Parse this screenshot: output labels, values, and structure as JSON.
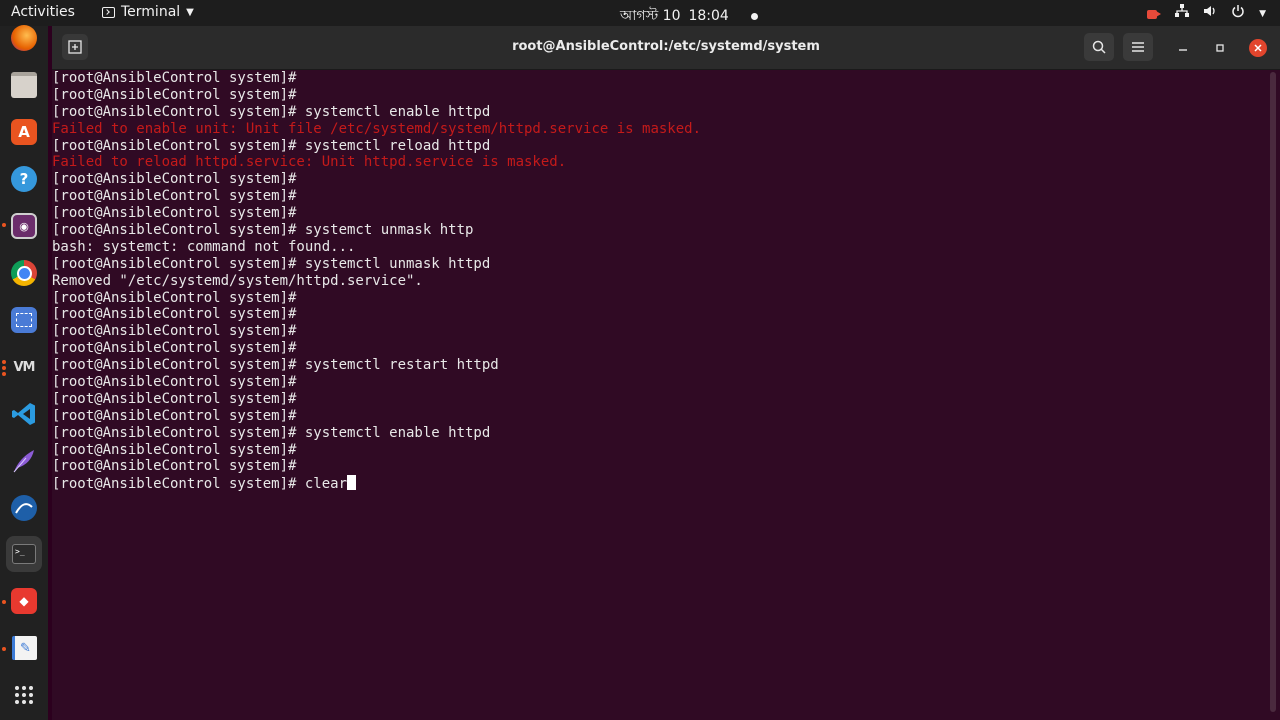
{
  "topbar": {
    "activities": "Activities",
    "app_name": "Terminal",
    "date": "আগস্ট 10",
    "time": "18:04"
  },
  "dock": {
    "items": [
      {
        "name": "firefox-icon"
      },
      {
        "name": "files-icon"
      },
      {
        "name": "software-center-icon"
      },
      {
        "name": "help-icon"
      },
      {
        "name": "media-icon"
      },
      {
        "name": "chrome-icon"
      },
      {
        "name": "screenshot-icon"
      },
      {
        "name": "vm-icon"
      },
      {
        "name": "vscode-icon"
      },
      {
        "name": "feather-icon"
      },
      {
        "name": "wave-icon"
      },
      {
        "name": "terminal-icon"
      },
      {
        "name": "anydesk-icon"
      },
      {
        "name": "text-editor-icon"
      },
      {
        "name": "app-grid-icon"
      }
    ]
  },
  "window": {
    "title": "root@AnsibleControl:/etc/systemd/system"
  },
  "terminal": {
    "lines": [
      {
        "text": "[root@AnsibleControl system]#",
        "type": "normal"
      },
      {
        "text": "[root@AnsibleControl system]#",
        "type": "normal"
      },
      {
        "text": "[root@AnsibleControl system]# systemctl enable httpd",
        "type": "normal"
      },
      {
        "text": "Failed to enable unit: Unit file /etc/systemd/system/httpd.service is masked.",
        "type": "err"
      },
      {
        "text": "[root@AnsibleControl system]# systemctl reload httpd",
        "type": "normal"
      },
      {
        "text": "Failed to reload httpd.service: Unit httpd.service is masked.",
        "type": "err"
      },
      {
        "text": "[root@AnsibleControl system]#",
        "type": "normal"
      },
      {
        "text": "[root@AnsibleControl system]#",
        "type": "normal"
      },
      {
        "text": "[root@AnsibleControl system]#",
        "type": "normal"
      },
      {
        "text": "[root@AnsibleControl system]# systemct unmask http",
        "type": "normal"
      },
      {
        "text": "bash: systemct: command not found...",
        "type": "normal"
      },
      {
        "text": "[root@AnsibleControl system]# systemctl unmask httpd",
        "type": "normal"
      },
      {
        "text": "Removed \"/etc/systemd/system/httpd.service\".",
        "type": "normal"
      },
      {
        "text": "[root@AnsibleControl system]#",
        "type": "normal"
      },
      {
        "text": "[root@AnsibleControl system]#",
        "type": "normal"
      },
      {
        "text": "[root@AnsibleControl system]#",
        "type": "normal"
      },
      {
        "text": "[root@AnsibleControl system]#",
        "type": "normal"
      },
      {
        "text": "[root@AnsibleControl system]# systemctl restart httpd",
        "type": "normal"
      },
      {
        "text": "[root@AnsibleControl system]#",
        "type": "normal"
      },
      {
        "text": "[root@AnsibleControl system]#",
        "type": "normal"
      },
      {
        "text": "[root@AnsibleControl system]#",
        "type": "normal"
      },
      {
        "text": "[root@AnsibleControl system]# systemctl enable httpd",
        "type": "normal"
      },
      {
        "text": "[root@AnsibleControl system]#",
        "type": "normal"
      },
      {
        "text": "[root@AnsibleControl system]#",
        "type": "normal"
      }
    ],
    "current_prompt": "[root@AnsibleControl system]# ",
    "current_input": "clear"
  },
  "colors": {
    "terminal_bg": "#300a24",
    "error_text": "#c41a1a",
    "close_button": "#e2452d"
  }
}
